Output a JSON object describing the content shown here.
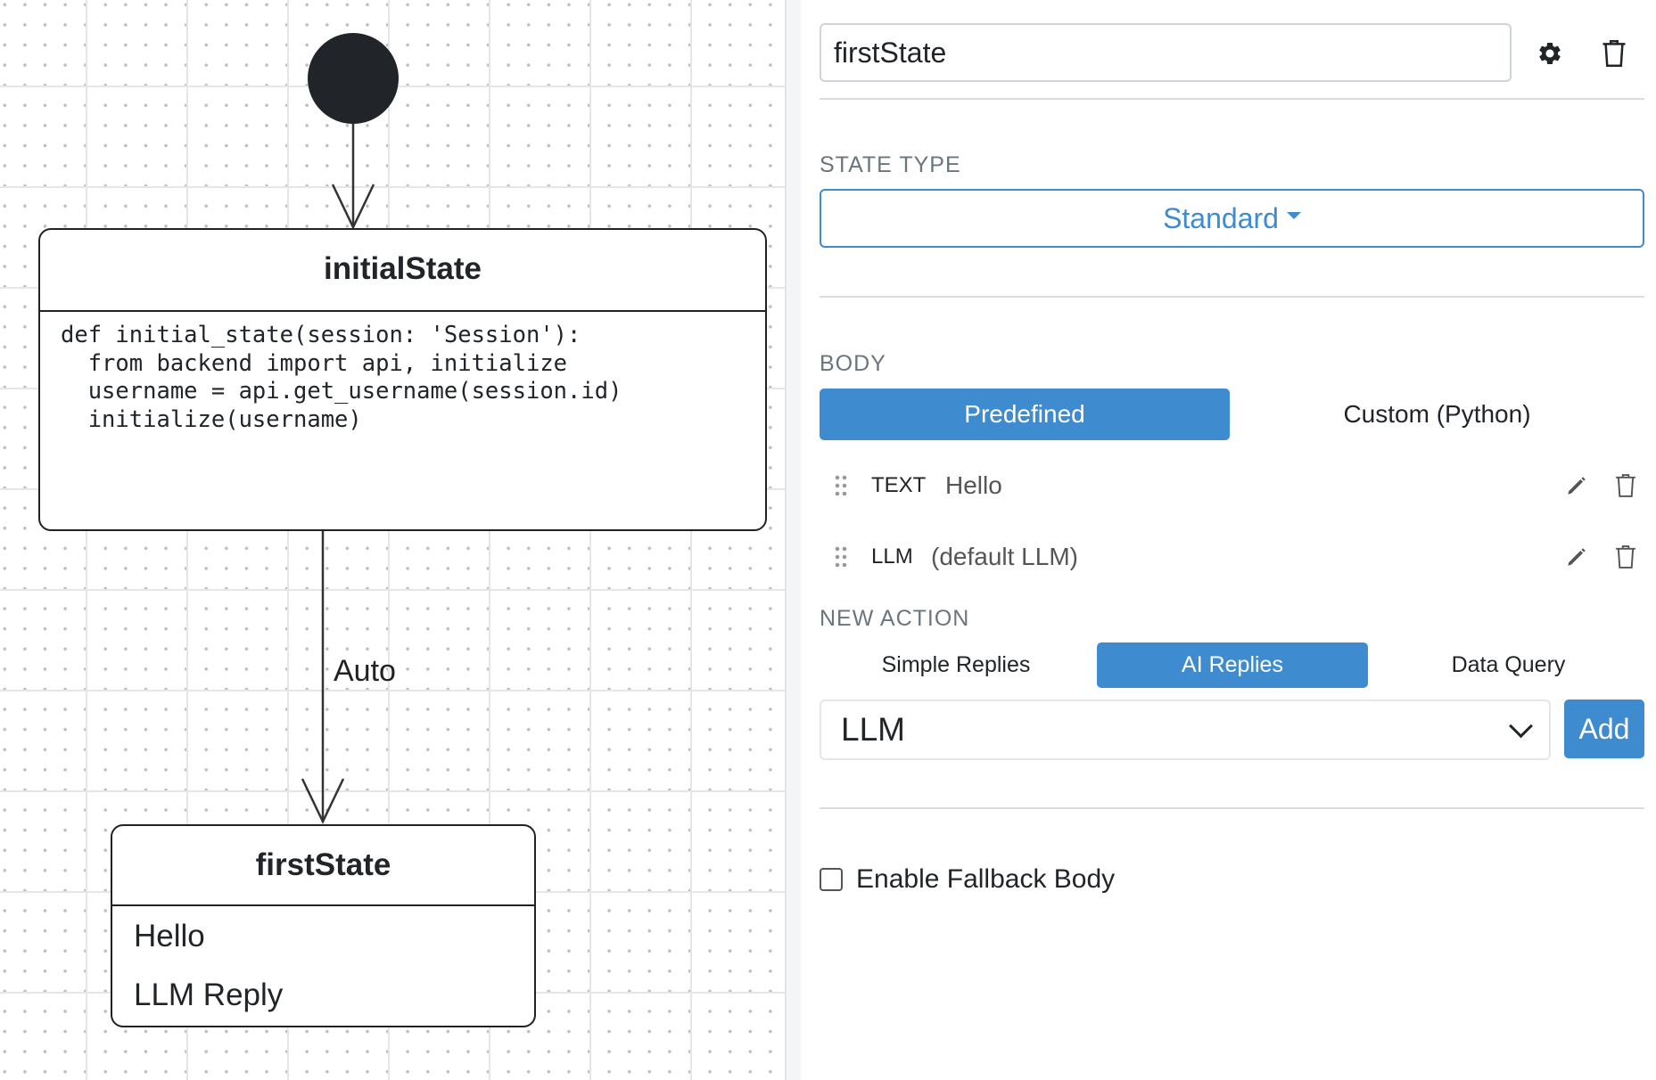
{
  "canvas": {
    "initial_state": {
      "title": "initialState",
      "code_lines": [
        "def initial_state(session: 'Session'):",
        "  from backend import api, initialize",
        "  username = api.get_username(session.id)",
        "  initialize(username)"
      ]
    },
    "transition": {
      "label": "Auto"
    },
    "first_state": {
      "title": "firstState",
      "body_lines": [
        "Hello",
        "LLM Reply"
      ]
    }
  },
  "panel": {
    "state_name": "firstState",
    "state_type_label": "STATE TYPE",
    "state_type_value": "Standard",
    "body_label": "BODY",
    "body_tabs": {
      "predefined": "Predefined",
      "custom": "Custom (Python)",
      "active": "predefined"
    },
    "actions": [
      {
        "kind": "TEXT",
        "value": "Hello"
      },
      {
        "kind": "LLM",
        "value": "(default LLM)"
      }
    ],
    "new_action_label": "NEW ACTION",
    "new_action_tabs": {
      "simple": "Simple Replies",
      "ai": "AI Replies",
      "data": "Data Query",
      "active": "ai"
    },
    "select_value": "LLM",
    "add_label": "Add",
    "fallback_label": "Enable Fallback Body",
    "fallback_checked": false,
    "accent_color": "#3f8bd0"
  },
  "icons": [
    "gear-icon",
    "trash-icon",
    "drag-handle-icon",
    "pencil-icon",
    "chevron-down-icon"
  ]
}
